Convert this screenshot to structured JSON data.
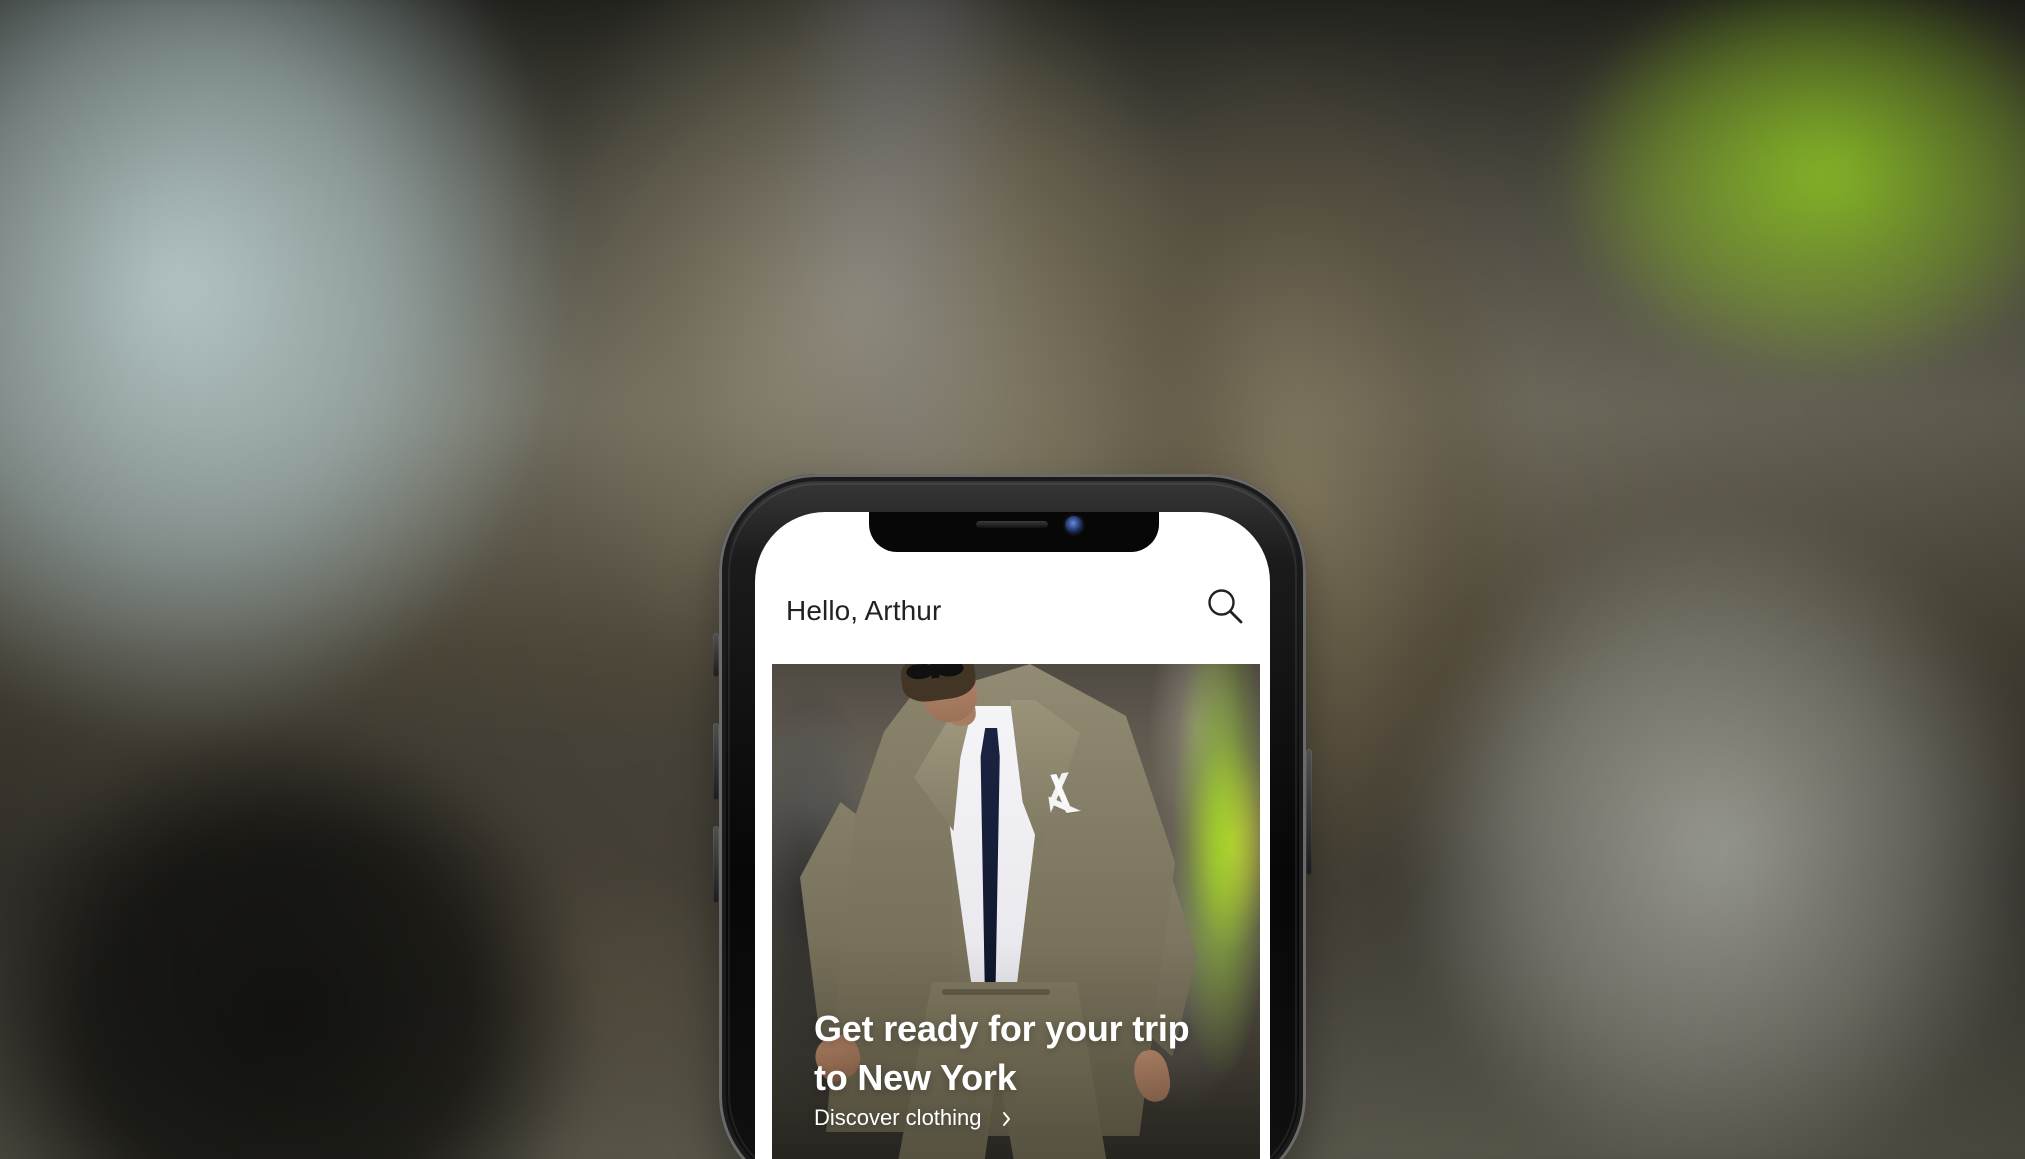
{
  "app": {
    "greeting": "Hello, Arthur",
    "search_icon": "search-icon",
    "hero": {
      "title": "Get ready for your trip to New York",
      "subtitle": "Discover clothing",
      "arrow_icon": "chevron-right-icon"
    }
  },
  "colors": {
    "accent_green": "#9AD429",
    "text_primary": "#222222",
    "hero_text": "#FFFFFF"
  }
}
